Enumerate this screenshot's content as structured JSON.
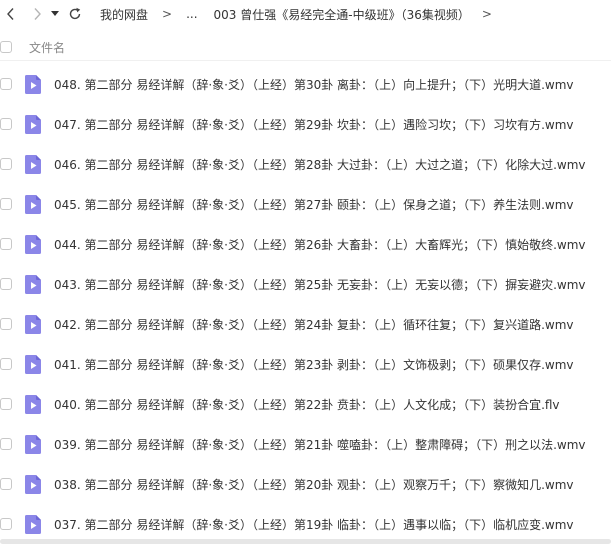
{
  "nav": {
    "back_icon": "chevron-left-icon",
    "forward_icon": "chevron-right-icon",
    "dropdown_icon": "caret-down-icon",
    "refresh_icon": "refresh-icon"
  },
  "breadcrumb": {
    "root": "我的网盘",
    "separator": ">",
    "ellipsis": "...",
    "current": "003 曾仕强《易经完全通-中级班》（36集视频）"
  },
  "table": {
    "column_name": "文件名"
  },
  "files": [
    "048. 第二部分 易经详解（辞·象·爻）（上经）第30卦 离卦：（上）向上提升；（下）光明大道.wmv",
    "047. 第二部分 易经详解（辞·象·爻）（上经）第29卦 坎卦：（上）遇险习坎；（下）习坎有方.wmv",
    "046. 第二部分 易经详解（辞·象·爻）（上经）第28卦 大过卦：（上）大过之道；（下）化除大过.wmv",
    "045. 第二部分 易经详解（辞·象·爻）（上经）第27卦 颐卦：（上）保身之道；（下）养生法则.wmv",
    "044. 第二部分 易经详解（辞·象·爻）（上经）第26卦 大畜卦：（上）大畜辉光；（下）慎始敬终.wmv",
    "043. 第二部分 易经详解（辞·象·爻）（上经）第25卦 无妄卦：（上）无妄以德；（下）摒妄避灾.wmv",
    "042. 第二部分 易经详解（辞·象·爻）（上经）第24卦 复卦：（上）循环往复；（下）复兴道路.wmv",
    "041. 第二部分 易经详解（辞·象·爻）（上经）第23卦 剥卦：（上）文饰极剥；（下）硕果仅存.wmv",
    "040. 第二部分 易经详解（辞·象·爻）（上经）第22卦 贲卦：（上）人文化成；（下）装扮合宜.flv",
    "039. 第二部分 易经详解（辞·象·爻）（上经）第21卦 噬嗑卦：（上）整肃障碍；（下）刑之以法.wmv",
    "038. 第二部分 易经详解（辞·象·爻）（上经）第20卦 观卦：（上）观察万千；（下）察微知几.wmv",
    "037. 第二部分 易经详解（辞·象·爻）（上经）第19卦 临卦：（上）遇事以临；（下）临机应变.wmv"
  ],
  "colors": {
    "file_icon": "#8b86e8",
    "file_icon_dark": "#6d67d6",
    "text": "#333333",
    "muted": "#888888"
  }
}
